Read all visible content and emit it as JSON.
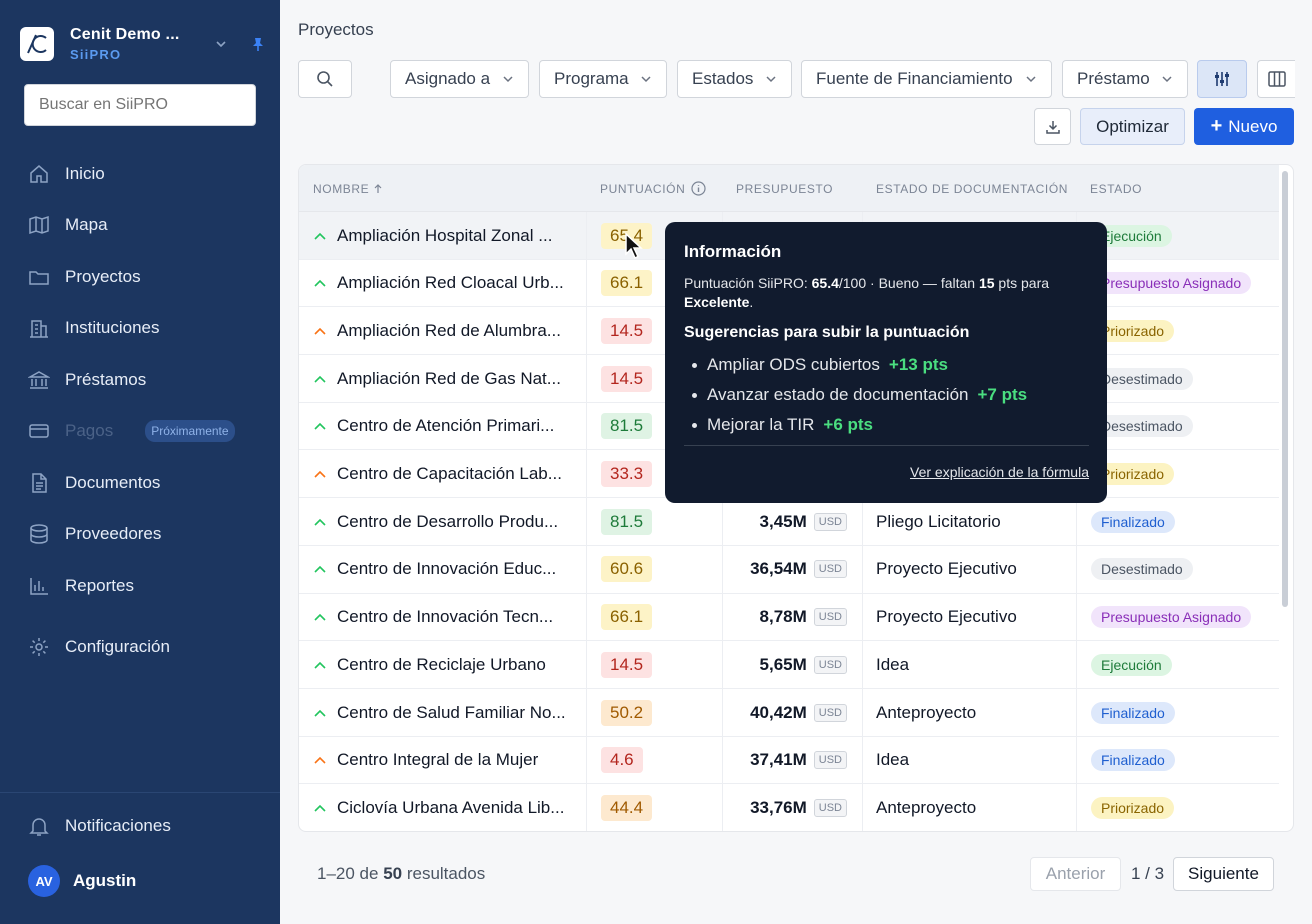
{
  "sidebar": {
    "org_name": "Cenit Demo ...",
    "app_name": "SiiPRO",
    "search_placeholder": "Buscar en SiiPRO",
    "nav": [
      {
        "label": "Inicio",
        "icon": "home-icon"
      },
      {
        "label": "Mapa",
        "icon": "map-icon"
      },
      {
        "label": "Proyectos",
        "icon": "folder-icon"
      },
      {
        "label": "Instituciones",
        "icon": "building-icon"
      },
      {
        "label": "Préstamos",
        "icon": "bank-icon"
      },
      {
        "label": "Pagos",
        "icon": "credit-card-icon",
        "disabled": true,
        "badge": "Próximamente"
      },
      {
        "label": "Documentos",
        "icon": "document-icon"
      },
      {
        "label": "Proveedores",
        "icon": "database-icon"
      },
      {
        "label": "Reportes",
        "icon": "bar-chart-icon"
      },
      {
        "label": "Configuración",
        "icon": "gear-icon"
      }
    ],
    "notifications_label": "Notificaciones",
    "user": {
      "initials": "AV",
      "name": "Agustin"
    }
  },
  "header": {
    "title": "Proyectos"
  },
  "filters": {
    "assigned": "Asignado a",
    "program": "Programa",
    "states": "Estados",
    "funding": "Fuente de Financiamiento",
    "loan": "Préstamo"
  },
  "actions": {
    "optimize": "Optimizar",
    "new": "Nuevo",
    "new_plus": "+"
  },
  "table": {
    "headers": {
      "name": "NOMBRE",
      "score": "PUNTUACIÓN",
      "budget": "PRESUPUESTO",
      "doc_state": "ESTADO DE DOCUMENTACIÓN",
      "state": "ESTADO"
    },
    "rows": [
      {
        "name": "Ampliación Hospital Zonal ...",
        "score": "65.4",
        "score_color": "yellow",
        "budget": "",
        "currency": "",
        "doc": "",
        "state": "Ejecución",
        "state_class": "exec"
      },
      {
        "name": "Ampliación Red Cloacal Urb...",
        "score": "66.1",
        "score_color": "yellow",
        "budget": "",
        "currency": "",
        "doc": "",
        "state": "Presupuesto Asignado",
        "state_class": "pres"
      },
      {
        "name": "Ampliación Red de Alumbra...",
        "score": "14.5",
        "score_color": "red",
        "budget": "",
        "currency": "",
        "doc": "",
        "state": "Priorizado",
        "state_class": "prio"
      },
      {
        "name": "Ampliación Red de Gas Nat...",
        "score": "14.5",
        "score_color": "red",
        "budget": "",
        "currency": "",
        "doc": "",
        "state": "Desestimado",
        "state_class": "des"
      },
      {
        "name": "Centro de Atención Primari...",
        "score": "81.5",
        "score_color": "green",
        "budget": "",
        "currency": "",
        "doc": "",
        "state": "Desestimado",
        "state_class": "des"
      },
      {
        "name": "Centro de Capacitación Lab...",
        "score": "33.3",
        "score_color": "red",
        "budget": "",
        "currency": "",
        "doc": "",
        "state": "Priorizado",
        "state_class": "prio"
      },
      {
        "name": "Centro de Desarrollo Produ...",
        "score": "81.5",
        "score_color": "green",
        "budget": "3,45M",
        "currency": "USD",
        "doc": "Pliego Licitatorio",
        "state": "Finalizado",
        "state_class": "fin"
      },
      {
        "name": "Centro de Innovación Educ...",
        "score": "60.6",
        "score_color": "yellow",
        "budget": "36,54M",
        "currency": "USD",
        "doc": "Proyecto Ejecutivo",
        "state": "Desestimado",
        "state_class": "des"
      },
      {
        "name": "Centro de Innovación Tecn...",
        "score": "66.1",
        "score_color": "yellow",
        "budget": "8,78M",
        "currency": "USD",
        "doc": "Proyecto Ejecutivo",
        "state": "Presupuesto Asignado",
        "state_class": "pres"
      },
      {
        "name": "Centro de Reciclaje Urbano",
        "score": "14.5",
        "score_color": "red",
        "budget": "5,65M",
        "currency": "USD",
        "doc": "Idea",
        "state": "Ejecución",
        "state_class": "exec"
      },
      {
        "name": "Centro de Salud Familiar No...",
        "score": "50.2",
        "score_color": "orange",
        "budget": "40,42M",
        "currency": "USD",
        "doc": "Anteproyecto",
        "state": "Finalizado",
        "state_class": "fin"
      },
      {
        "name": "Centro Integral de la Mujer",
        "score": "4.6",
        "score_color": "red",
        "budget": "37,41M",
        "currency": "USD",
        "doc": "Idea",
        "state": "Finalizado",
        "state_class": "fin"
      },
      {
        "name": "Ciclovía Urbana Avenida Lib...",
        "score": "44.4",
        "score_color": "orange",
        "budget": "33,76M",
        "currency": "USD",
        "doc": "Anteproyecto",
        "state": "Priorizado",
        "state_class": "prio"
      }
    ]
  },
  "tooltip": {
    "title": "Información",
    "line_prefix": "Puntuación SiiPRO: ",
    "score": "65.4",
    "score_max": "/100 · Bueno — faltan ",
    "missing_pts": "15",
    "line_mid": " pts para ",
    "next_level": "Excelente",
    "line_end": ".",
    "suggestions_title": "Sugerencias para subir la puntuación",
    "suggestions": [
      {
        "text": "Ampliar ODS cubiertos",
        "pts": "+13 pts"
      },
      {
        "text": "Avanzar estado de documentación",
        "pts": "+7 pts"
      },
      {
        "text": "Mejorar la TIR",
        "pts": "+6 pts"
      }
    ],
    "link": "Ver explicación de la fórmula"
  },
  "pagination": {
    "range": "1–20",
    "of": " de ",
    "total": "50",
    "results": " resultados",
    "prev": "Anterior",
    "page": "1 / 3",
    "next": "Siguiente"
  },
  "colors": {
    "sidebar": "#1c3660",
    "primary": "#1f5fe0",
    "tooltip": "#111b2e"
  }
}
